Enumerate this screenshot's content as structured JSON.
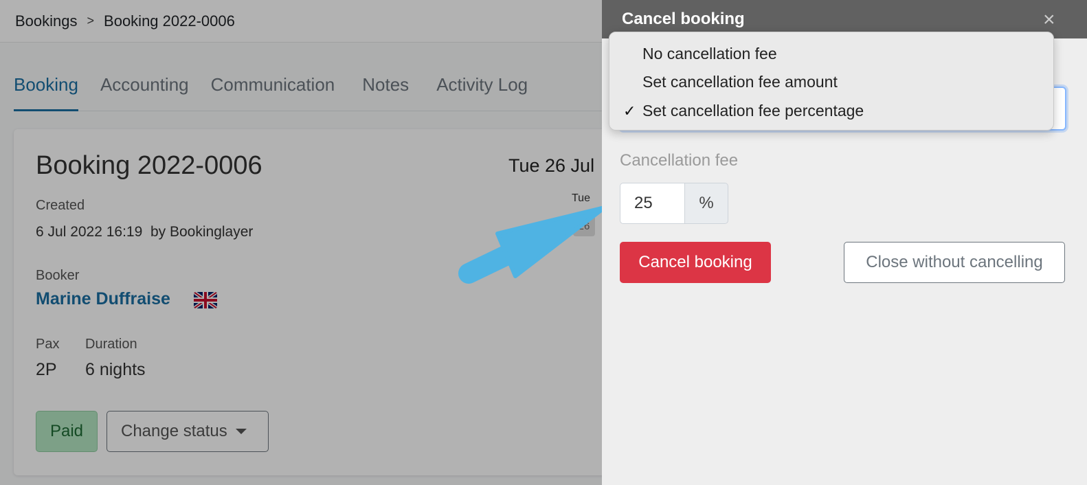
{
  "breadcrumb": {
    "root": "Bookings",
    "separator": ">",
    "current": "Booking 2022-0006"
  },
  "tabs": [
    {
      "label": "Booking",
      "active": true
    },
    {
      "label": "Accounting",
      "active": false
    },
    {
      "label": "Communication",
      "active": false
    },
    {
      "label": "Notes",
      "active": false
    },
    {
      "label": "Activity Log",
      "active": false
    }
  ],
  "booking": {
    "title": "Booking 2022-0006",
    "created_label": "Created",
    "created_value": "6 Jul 2022 16:19  by Bookinglayer",
    "booker_label": "Booker",
    "booker_name": "Marine Duffraise",
    "pax_label": "Pax",
    "pax_value": "2P",
    "duration_label": "Duration",
    "duration_value": "6 nights",
    "date_heading": "Tue 26 Jul",
    "calendar_day": "Tue",
    "calendar_date": "26",
    "paid_label": "Paid",
    "change_status_label": "Change status"
  },
  "panel": {
    "title": "Cancel booking",
    "close_icon": "×",
    "dropdown_options": [
      {
        "label": "No cancellation fee",
        "selected": false
      },
      {
        "label": "Set cancellation fee amount",
        "selected": false
      },
      {
        "label": "Set cancellation fee percentage",
        "selected": true
      }
    ],
    "checkmark": "✓",
    "fee_label": "Cancellation fee",
    "fee_value": "25",
    "fee_unit": "%",
    "cancel_button": "Cancel booking",
    "close_button": "Close without cancelling"
  },
  "colors": {
    "accent": "#1b6fa3",
    "danger": "#dc3545",
    "arrow": "#4fb3e3",
    "paid_bg": "#b4e6c2"
  }
}
